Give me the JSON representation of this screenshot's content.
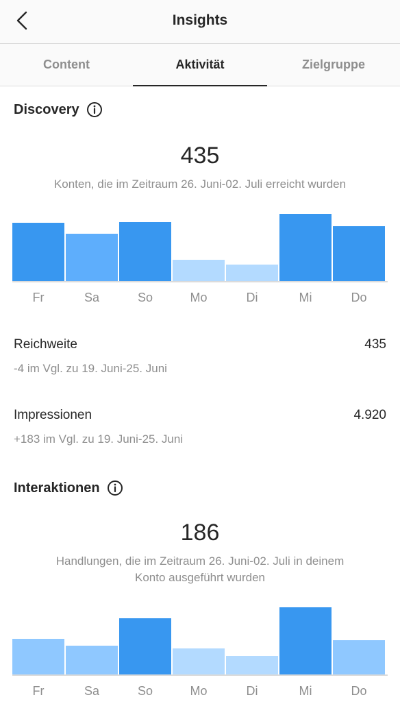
{
  "header": {
    "title": "Insights",
    "back_icon": "chevron-left-icon"
  },
  "tabs": [
    {
      "label": "Content",
      "active": false
    },
    {
      "label": "Aktivität",
      "active": true
    },
    {
      "label": "Zielgruppe",
      "active": false
    }
  ],
  "discovery": {
    "title": "Discovery",
    "total": "435",
    "caption": "Konten, die im Zeitraum 26. Juni-02. Juli erreicht wurden",
    "chart_data": {
      "type": "bar",
      "categories": [
        "Fr",
        "Sa",
        "So",
        "Mo",
        "Di",
        "Mi",
        "Do"
      ],
      "values": [
        85,
        69,
        86,
        31,
        24,
        98,
        80
      ],
      "colors": [
        "#3897f0",
        "#5eaefc",
        "#3897f0",
        "#b3daff",
        "#b3daff",
        "#3897f0",
        "#3897f0"
      ],
      "ylim": [
        0,
        100
      ]
    },
    "metrics": [
      {
        "label": "Reichweite",
        "value": "435",
        "sub": "-4 im Vgl. zu 19. Juni-25. Juni"
      },
      {
        "label": "Impressionen",
        "value": "4.920",
        "sub": "+183 im Vgl. zu 19. Juni-25. Juni"
      }
    ]
  },
  "interactions": {
    "title": "Interaktionen",
    "total": "186",
    "caption_line1": "Handlungen, die im Zeitraum 26. Juni-02. Juli in deinem",
    "caption_line2": "Konto ausgeführt wurden",
    "chart_data": {
      "type": "bar",
      "categories": [
        "Fr",
        "Sa",
        "So",
        "Mo",
        "Di",
        "Mi",
        "Do"
      ],
      "values": [
        52,
        42,
        82,
        38,
        27,
        98,
        50
      ],
      "colors": [
        "#8fc8ff",
        "#8fc8ff",
        "#3897f0",
        "#b3daff",
        "#b3daff",
        "#3897f0",
        "#8fc8ff"
      ],
      "ylim": [
        0,
        100
      ]
    }
  }
}
